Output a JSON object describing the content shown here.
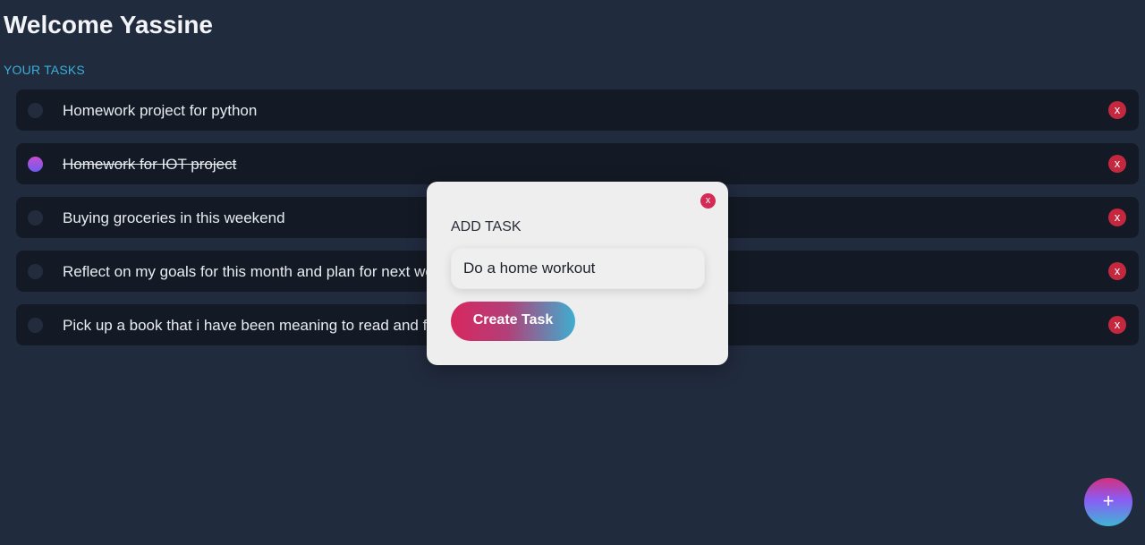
{
  "header": {
    "title": "Welcome Yassine",
    "subtitle": "YOUR TASKS"
  },
  "tasks": [
    {
      "text": "Homework project for python",
      "done": false,
      "delete_label": "x"
    },
    {
      "text": "Homework for IOT project",
      "done": true,
      "delete_label": "x"
    },
    {
      "text": "Buying groceries in this weekend",
      "done": false,
      "delete_label": "x"
    },
    {
      "text": "Reflect on my goals for this month and plan for next week",
      "done": false,
      "delete_label": "x"
    },
    {
      "text": "Pick up a book that i have been meaning to read and finish it",
      "done": false,
      "delete_label": "x"
    }
  ],
  "modal": {
    "close_label": "x",
    "heading": "ADD TASK",
    "input_value": "Do a home workout",
    "submit_label": "Create Task"
  },
  "fab": {
    "label": "+"
  },
  "colors": {
    "background": "#212b3e",
    "task_background": "#141a25",
    "accent_cyan": "#3ab0d9",
    "delete_red": "#c4283e",
    "modal_background": "#eeeeee"
  }
}
